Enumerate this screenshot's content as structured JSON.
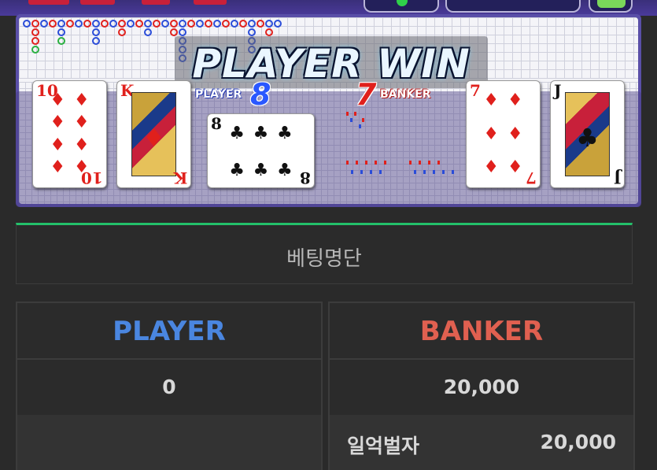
{
  "game": {
    "result_text": "PLAYER WIN",
    "player": {
      "label": "PLAYER",
      "score": "8",
      "cards": [
        {
          "rank": "10",
          "suit": "♦",
          "color": "#e0201c"
        },
        {
          "rank": "K",
          "suit": "♦",
          "color": "#e0201c"
        },
        {
          "rank": "8",
          "suit": "♣",
          "color": "#111111"
        }
      ]
    },
    "banker": {
      "label": "BANKER",
      "score": "7",
      "cards": [
        {
          "rank": "7",
          "suit": "♦",
          "color": "#e0201c"
        },
        {
          "rank": "J",
          "suit": "♣",
          "color": "#111111"
        }
      ]
    }
  },
  "bet_list": {
    "title": "베팅명단"
  },
  "columns": {
    "player": {
      "title": "PLAYER",
      "title_color": "#4a86e0",
      "total": "0"
    },
    "banker": {
      "title": "BANKER",
      "title_color": "#e06050",
      "total": "20,000",
      "bets": [
        {
          "name": "일억벌자",
          "amount": "20,000"
        }
      ]
    }
  },
  "colors": {
    "accent": "#23c06a",
    "panel": "#2b2b2b",
    "border": "#3c3c3c"
  }
}
